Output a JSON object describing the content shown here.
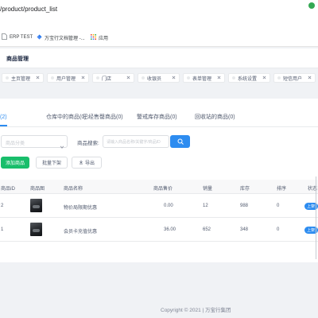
{
  "browser": {
    "url": "/product/product_list",
    "bookmarks": [
      {
        "label": "ERP TEST",
        "icon": "document-icon"
      },
      {
        "label": "万宝行文档管理 -...",
        "icon": "kite-icon"
      },
      {
        "label": "应用",
        "icon": "apps-grid-icon"
      }
    ]
  },
  "header": {
    "title": "商品管理"
  },
  "nav_tags": [
    {
      "label": "主页管理"
    },
    {
      "label": "用户管理"
    },
    {
      "label": "门店"
    },
    {
      "label": "收银员"
    },
    {
      "label": "表单管理"
    },
    {
      "label": "系统设置"
    },
    {
      "label": "短信用户"
    }
  ],
  "tabs": [
    {
      "label": "(2)",
      "active": true
    },
    {
      "label": "仓库中的商品(0)"
    },
    {
      "label": "已经售罄商品(0)"
    },
    {
      "label": "警戒库存商品(0)"
    },
    {
      "label": "回收站的商品(0)"
    }
  ],
  "filters": {
    "category_placeholder": "商品分类",
    "search_label": "商品搜索:",
    "search_placeholder": "请输入商品名称/关键字/商品ID"
  },
  "actions": {
    "add": "添加商品",
    "batch_off": "批量下架",
    "export": "导出"
  },
  "table": {
    "columns": {
      "id": "商品ID",
      "image": "商品图",
      "name": "商品名称",
      "price": "商品售价",
      "sales": "销量",
      "stock": "库存",
      "sort": "排序",
      "status": "状态"
    },
    "rows": [
      {
        "id": "2",
        "name": "物价局限期优惠",
        "price": "0.00",
        "sales": "12",
        "stock": "988",
        "sort": "0",
        "status": "上架"
      },
      {
        "id": "1",
        "name": "会员卡充值优惠",
        "price": "36.00",
        "sales": "652",
        "stock": "348",
        "sort": "0",
        "status": "上架"
      }
    ]
  },
  "footer": {
    "copyright": "Copyright © 2021 | 万宝行集团"
  },
  "colors": {
    "primary": "#2d8cf0",
    "success": "#19be6b",
    "page_bg": "#f0f2f5",
    "browser_status": "#34a853"
  }
}
